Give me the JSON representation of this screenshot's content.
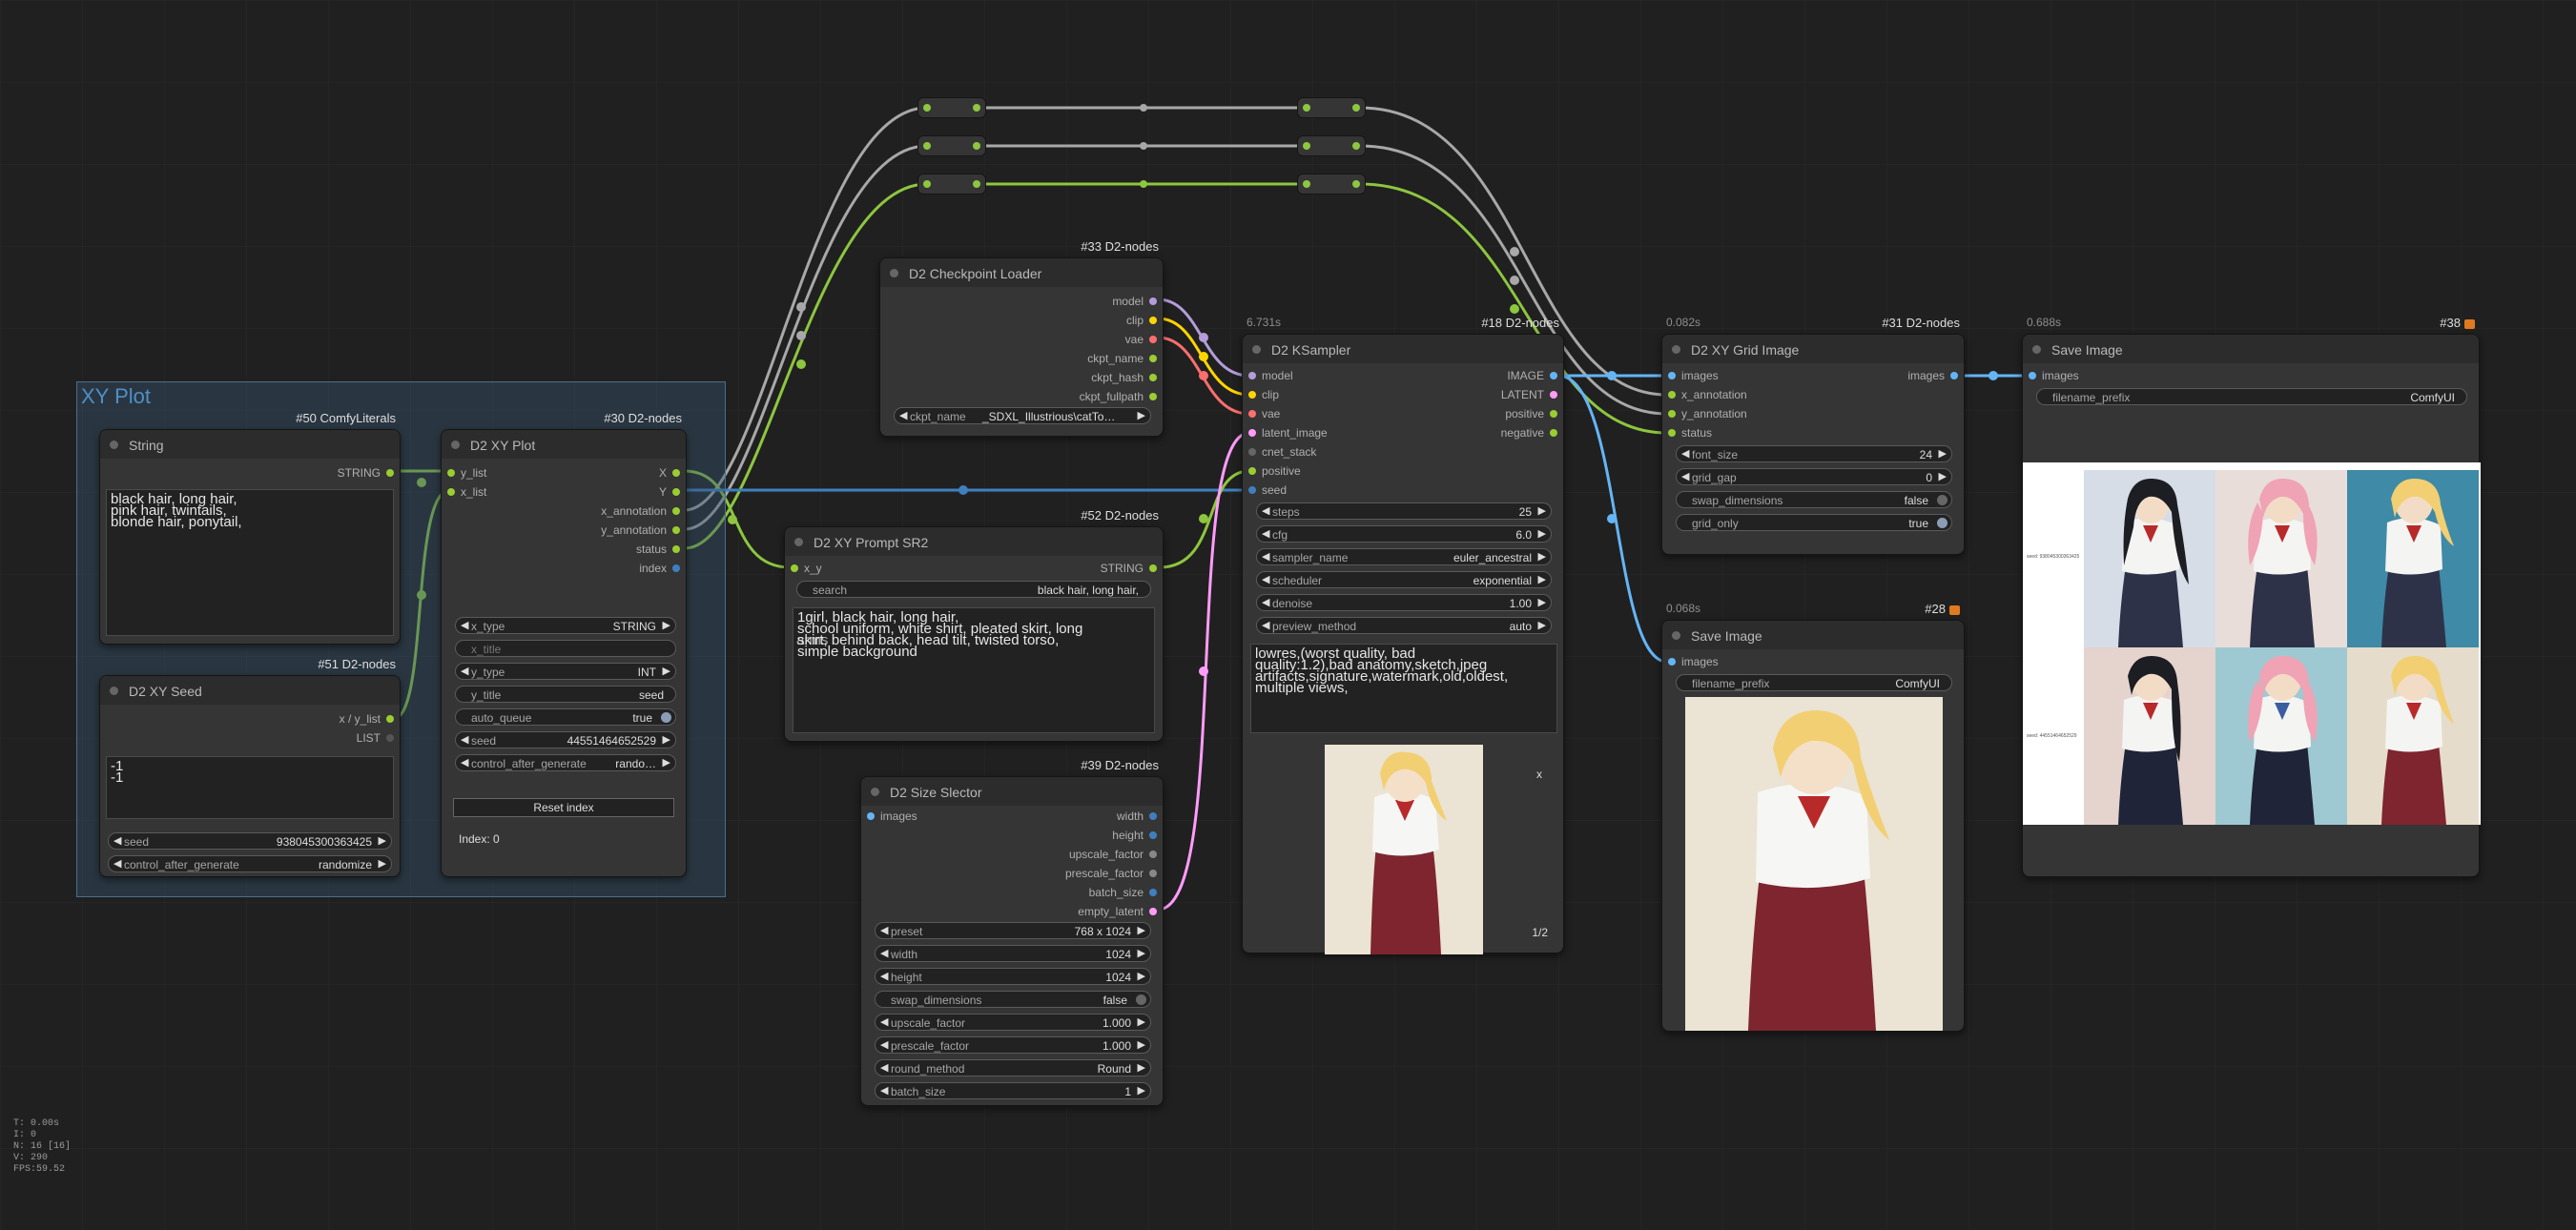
{
  "group": {
    "title": "XY Plot"
  },
  "nodes": {
    "string": {
      "title": "String",
      "badge": "#50 ComfyLiterals",
      "out": "STRING",
      "text": "black hair, long hair,\npink hair, twintails,\nblonde hair, ponytail,"
    },
    "seed": {
      "title": "D2 XY Seed",
      "badge": "#51 D2-nodes",
      "out1": "x / y_list",
      "out2": "LIST",
      "text": "-1\n-1",
      "seed_label": "seed",
      "seed_value": "938045300363425",
      "cag_label": "control_after_generate",
      "cag_value": "randomize"
    },
    "xyplot": {
      "title": "D2 XY Plot",
      "badge": "#30 D2-nodes",
      "in1": "y_list",
      "in2": "x_list",
      "outs": [
        "X",
        "Y",
        "x_annotation",
        "y_annotation",
        "status",
        "index"
      ],
      "x_type_label": "x_type",
      "x_type_value": "STRING",
      "x_title": "x_title",
      "y_type_label": "y_type",
      "y_type_value": "INT",
      "y_title_label": "y_title",
      "y_title_value": "seed",
      "auto_queue_label": "auto_queue",
      "auto_queue_value": "true",
      "seed_label": "seed",
      "seed_value": "44551464652529",
      "cag_label": "control_after_generate",
      "cag_value": "rando…",
      "reset_label": "Reset index",
      "index_text": "Index: 0"
    },
    "ckpt": {
      "title": "D2 Checkpoint Loader",
      "badge": "#33 D2-nodes",
      "outs": [
        "model",
        "clip",
        "vae",
        "ckpt_name",
        "ckpt_hash",
        "ckpt_fullpath"
      ],
      "ckpt_label": "ckpt_name",
      "ckpt_value": "_SDXL_Illustrious\\catTo…"
    },
    "prompt": {
      "title": "D2 XY Prompt SR2",
      "badge": "#52 D2-nodes",
      "in": "x_y",
      "out": "STRING",
      "search_label": "search",
      "search_value": "black hair, long hair,",
      "text": "1girl, black hair, long hair,\nschool uniform, white shirt, pleated skirt, long\nskirt, behind back, head tilt, twisted torso,\nsimple background",
      "overlap": "arms"
    },
    "size": {
      "title": "D2 Size Slector",
      "badge": "#39 D2-nodes",
      "in": "images",
      "outs": [
        "width",
        "height",
        "upscale_factor",
        "prescale_factor",
        "batch_size",
        "empty_latent"
      ],
      "widgets": [
        {
          "label": "preset",
          "value": "768 x 1024"
        },
        {
          "label": "width",
          "value": "1024"
        },
        {
          "label": "height",
          "value": "1024"
        },
        {
          "label": "swap_dimensions",
          "value": "false"
        },
        {
          "label": "upscale_factor",
          "value": "1.000"
        },
        {
          "label": "prescale_factor",
          "value": "1.000"
        },
        {
          "label": "round_method",
          "value": "Round"
        },
        {
          "label": "batch_size",
          "value": "1"
        }
      ]
    },
    "ksampler": {
      "title": "D2 KSampler",
      "badge": "#18 D2-nodes",
      "time": "6.731s",
      "ins": [
        "model",
        "clip",
        "vae",
        "latent_image",
        "cnet_stack",
        "positive",
        "seed"
      ],
      "outs": [
        "IMAGE",
        "LATENT",
        "positive",
        "negative"
      ],
      "widgets": [
        {
          "label": "steps",
          "value": "25"
        },
        {
          "label": "cfg",
          "value": "6.0"
        },
        {
          "label": "sampler_name",
          "value": "euler_ancestral"
        },
        {
          "label": "scheduler",
          "value": "exponential"
        },
        {
          "label": "denoise",
          "value": "1.00"
        },
        {
          "label": "preview_method",
          "value": "auto"
        }
      ],
      "negative_text": "lowres,(worst quality, bad\nquality:1.2),bad anatomy,sketch,jpeg\nartifacts,signature,watermark,old,oldest,\nmultiple views,",
      "close": "x",
      "counter": "1/2"
    },
    "grid": {
      "title": "D2 XY Grid Image",
      "badge": "#31 D2-nodes",
      "time": "0.082s",
      "ins": [
        "images",
        "x_annotation",
        "y_annotation",
        "status"
      ],
      "out": "images",
      "widgets": [
        {
          "label": "font_size",
          "value": "24"
        },
        {
          "label": "grid_gap",
          "value": "0"
        },
        {
          "label": "swap_dimensions",
          "value": "false"
        },
        {
          "label": "grid_only",
          "value": "true"
        }
      ]
    },
    "save38": {
      "title": "Save Image",
      "badge": "#38",
      "time": "0.688s",
      "in": "images",
      "prefix_label": "filename_prefix",
      "prefix_value": "ComfyUI",
      "row_labels": [
        "seed: 938045300363425",
        "seed: 44551464652529"
      ]
    },
    "save28": {
      "title": "Save Image",
      "badge": "#28",
      "time": "0.068s",
      "in": "images",
      "prefix_label": "filename_prefix",
      "prefix_value": "ComfyUI"
    }
  },
  "stats": "T: 0.00s\nI: 0\nN: 16 [16]\nV: 290\nFPS:59.52",
  "colors": {
    "string": "#9acd32",
    "int": "#9acd32",
    "image": "#64b5f6",
    "model": "#b39ddb",
    "clip": "#ffd500",
    "vae": "#ff6e6e",
    "latent": "#ff9cf9",
    "cond": "#ffa931",
    "link_gray": "#a8a8a8"
  }
}
